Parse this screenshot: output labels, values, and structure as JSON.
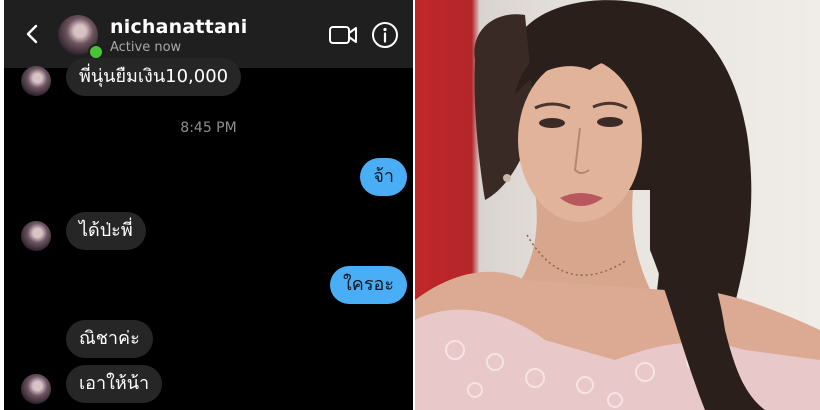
{
  "header": {
    "username": "nichanattani",
    "status": "Active now",
    "icons": {
      "back": "chevron-left-icon",
      "video": "video-camera-icon",
      "info": "info-icon"
    },
    "online_color": "#48c437"
  },
  "messages": [
    {
      "from": "them",
      "text": "พี่นุ่นยืมเงิน10,000"
    },
    {
      "from": "me",
      "text": "จ้า"
    },
    {
      "from": "them",
      "text": "ได้ป่ะพี่"
    },
    {
      "from": "me",
      "text": "ใครอะ"
    },
    {
      "from": "them",
      "text": "ณิชาค่ะ"
    },
    {
      "from": "them",
      "text": "เอาให้น้า"
    }
  ],
  "timestamp": "8:45 PM",
  "colors": {
    "chat_background": "#000000",
    "incoming_bubble": "#262626",
    "outgoing_bubble": "#4aaef6"
  }
}
